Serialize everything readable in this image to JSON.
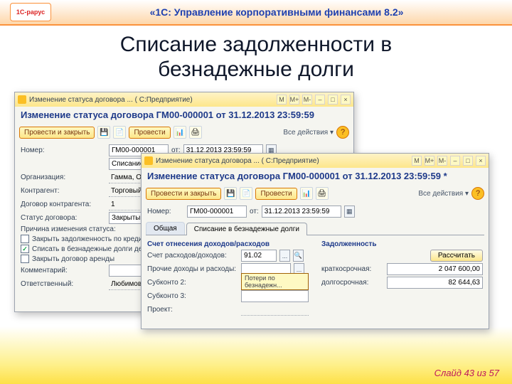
{
  "header": {
    "logo_text": "1С-рарус",
    "title": "«1С: Управление корпоративными финансами 8.2»"
  },
  "slide": {
    "title_line1": "Списание задолженности в",
    "title_line2": "безнадежные долги"
  },
  "win_common": {
    "titlebar_prefix": "Изменение статуса договора ... ( С:Предприятие)",
    "btn_m_plus": "M+",
    "btn_m": "M",
    "btn_m_minus": "M-",
    "btn_min": "–",
    "btn_max": "□",
    "btn_close": "×",
    "provesti_zakryt": "Провести и закрыть",
    "provesti": "Провести",
    "all_actions": "Все действия ▾",
    "help": "?",
    "nomer_lbl": "Номер:",
    "ot_lbl": "от:",
    "sel": "...",
    "cal": "▦",
    "dropdown": "▾"
  },
  "win1": {
    "doc_header": "Изменение статуса договора ГМ00-000001 от 31.12.2013 23:59:59",
    "nomer_val": "ГМ00-000001",
    "date_val": "31.12.2013 23:59:59",
    "type_val": "Списание в безнадежные долги",
    "org_lbl": "Организация:",
    "org_val": "Гамма, ООО",
    "contr_lbl": "Контрагент:",
    "contr_val": "Торговый дом",
    "dog_lbl": "Договор контрагента:",
    "dog_val": "1",
    "status_lbl": "Статус договора:",
    "status_val": "Закрытый",
    "reason_lbl": "Причина изменения статуса:",
    "chk1_lbl": "Закрыть задолженность по кредиту/займу",
    "chk2_lbl": "Списать в безнадежные долги дебиторскую",
    "chk3_lbl": "Закрыть договор аренды",
    "comment_lbl": "Комментарий:",
    "resp_lbl": "Ответственный:",
    "resp_val": "Любимов"
  },
  "win2": {
    "doc_header": "Изменение статуса договора ГМ00-000001 от 31.12.2013 23:59:59 *",
    "nomer_val": "ГМ00-000001",
    "date_val": "31.12.2013 23:59:59",
    "tab_general": "Общая",
    "tab_writeoff": "Списание в безнадежные долги",
    "group_accounts": "Счет отнесения доходов/расходов",
    "group_debt": "Задолженность",
    "acc_lbl": "Счет расходов/доходов:",
    "acc_val": "91.02",
    "other_lbl": "Прочие доходы и расходы:",
    "other_tooltip": "Потери по безнадежн...",
    "sub2_lbl": "Субконто 2:",
    "sub3_lbl": "Субконто 3:",
    "project_lbl": "Проект:",
    "calc_btn": "Рассчитать",
    "short_lbl": "краткосрочная:",
    "short_val": "2 047 600,00",
    "long_lbl": "долгосрочная:",
    "long_val": "82 644,63"
  },
  "footer": {
    "text": "Слайд 43 из 57"
  }
}
